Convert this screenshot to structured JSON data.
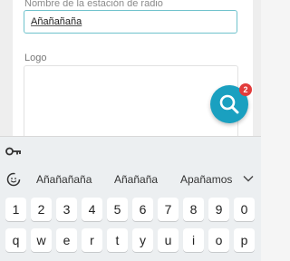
{
  "form": {
    "station_label": "Nombre de la estación de radio",
    "station_value": "Añañañaña",
    "logo_label": "Logo"
  },
  "fab": {
    "icon": "search-icon",
    "badge": "2",
    "color": "#1aa0c0",
    "badge_color": "#e23b3b"
  },
  "keyboard": {
    "toolbar_icon": "key-icon",
    "suggestion_icon": "emoji-icon",
    "suggestions": [
      "Añañañaña",
      "Añañaña",
      "Apañamos"
    ],
    "collapse_icon": "chevron-down-icon",
    "number_row": [
      "1",
      "2",
      "3",
      "4",
      "5",
      "6",
      "7",
      "8",
      "9",
      "0"
    ],
    "letter_row": [
      "q",
      "w",
      "e",
      "r",
      "t",
      "y",
      "u",
      "i",
      "o",
      "p"
    ]
  }
}
